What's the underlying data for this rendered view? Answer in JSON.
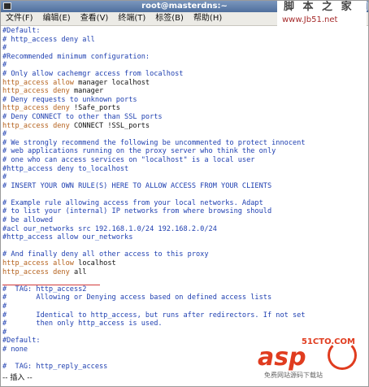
{
  "window": {
    "title": "root@masterdns:~",
    "buttons": [
      "_",
      "□",
      "×"
    ]
  },
  "menu": [
    "文件(F)",
    "编辑(E)",
    "查看(V)",
    "终端(T)",
    "标签(B)",
    "帮助(H)"
  ],
  "watermark_top": {
    "line1": "脚 本 之 家",
    "line2": "www.Jb51.net"
  },
  "watermark_bottom": {
    "brand": "asp",
    "small": "51CTO.COM",
    "sub": "免费网站源码下载站"
  },
  "status": "-- 插入 --",
  "lines": [
    [
      [
        "cm",
        "#Default:"
      ]
    ],
    [
      [
        "cm",
        "# http_access deny all"
      ]
    ],
    [
      [
        "cm",
        "#"
      ]
    ],
    [
      [
        "cm",
        "#Recommended minimum configuration:"
      ]
    ],
    [
      [
        "cm",
        "#"
      ]
    ],
    [
      [
        "cm",
        "# Only allow cachemgr access from localhost"
      ]
    ],
    [
      [
        "kw",
        "http_access allow"
      ],
      [
        "tx",
        " manager localhost"
      ]
    ],
    [
      [
        "kw",
        "http_access deny"
      ],
      [
        "tx",
        " manager"
      ]
    ],
    [
      [
        "cm",
        "# Deny requests to unknown ports"
      ]
    ],
    [
      [
        "kw",
        "http_access deny"
      ],
      [
        "tx",
        " !Safe_ports"
      ]
    ],
    [
      [
        "cm",
        "# Deny CONNECT to other than SSL ports"
      ]
    ],
    [
      [
        "kw",
        "http_access deny"
      ],
      [
        "tx",
        " CONNECT !SSL_ports"
      ]
    ],
    [
      [
        "cm",
        "#"
      ]
    ],
    [
      [
        "cm",
        "# We strongly recommend the following be uncommented to protect innocent"
      ]
    ],
    [
      [
        "cm",
        "# web applications running on the proxy server who think the only"
      ]
    ],
    [
      [
        "cm",
        "# one who can access services on \"localhost\" is a local user"
      ]
    ],
    [
      [
        "cm",
        "#http_access deny to_localhost"
      ]
    ],
    [
      [
        "cm",
        "#"
      ]
    ],
    [
      [
        "cm",
        "# INSERT YOUR OWN RULE(S) HERE TO ALLOW ACCESS FROM YOUR CLIENTS"
      ]
    ],
    [
      [
        "cm",
        ""
      ]
    ],
    [
      [
        "cm",
        "# Example rule allowing access from your local networks. Adapt"
      ]
    ],
    [
      [
        "cm",
        "# to list your (internal) IP networks from where browsing should"
      ]
    ],
    [
      [
        "cm",
        "# be allowed"
      ]
    ],
    [
      [
        "cm",
        "#acl our_networks src 192.168.1.0/24 192.168.2.0/24"
      ]
    ],
    [
      [
        "cm",
        "#http_access allow our_networks"
      ]
    ],
    [
      [
        "cm",
        ""
      ]
    ],
    [
      [
        "cm",
        "# And finally deny all other access to this proxy"
      ]
    ],
    [
      [
        "kw",
        "http_access allow"
      ],
      [
        "tx",
        " localhost"
      ]
    ],
    [
      [
        "kw",
        "http_access deny"
      ],
      [
        "tx",
        " all"
      ]
    ],
    [
      [
        "cm",
        ""
      ]
    ],
    [
      [
        "cm",
        "#  TAG: http_access2"
      ]
    ],
    [
      [
        "cm",
        "#       Allowing or Denying access based on defined access lists"
      ]
    ],
    [
      [
        "cm",
        "#"
      ]
    ],
    [
      [
        "cm",
        "#       Identical to http_access, but runs after redirectors. If not set"
      ]
    ],
    [
      [
        "cm",
        "#       then only http_access is used."
      ]
    ],
    [
      [
        "cm",
        "#"
      ]
    ],
    [
      [
        "cm",
        "#Default:"
      ]
    ],
    [
      [
        "cm",
        "# none"
      ]
    ],
    [
      [
        "cm",
        ""
      ]
    ],
    [
      [
        "cm",
        "#  TAG: http_reply_access"
      ]
    ]
  ]
}
